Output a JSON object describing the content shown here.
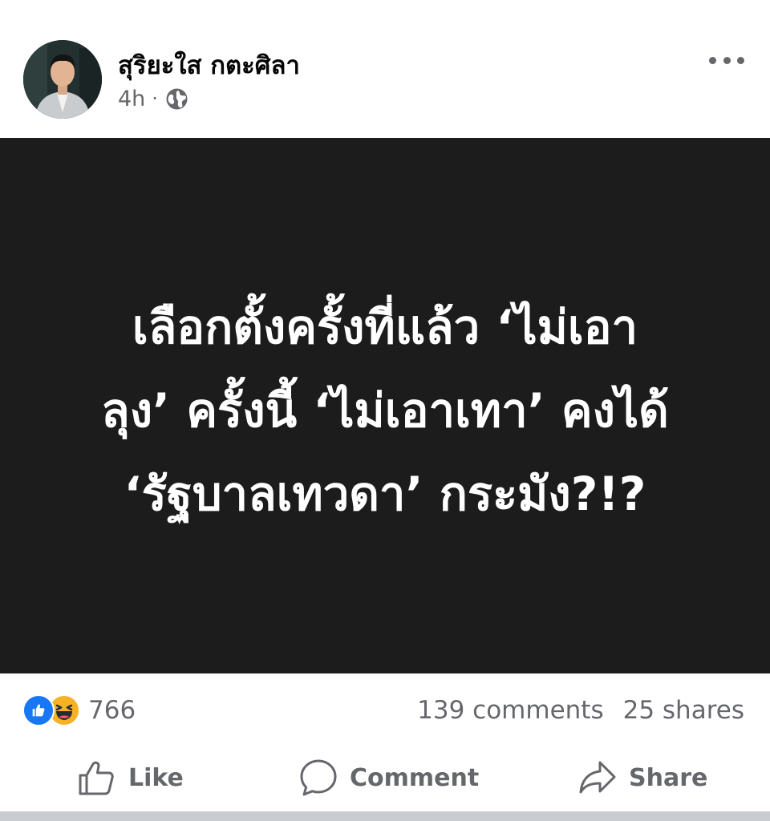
{
  "post": {
    "author": "สุริยะใส กตะศิลา",
    "timestamp": "4h",
    "separator": "·",
    "privacy_icon": "globe-icon",
    "more_icon": "more-horizontal-icon",
    "image_text_lines": [
      "เลือกตั้งครั้งที่แล้ว ‘ไม่เอา",
      "ลุง’ ครั้งนี้ ‘ไม่เอาเทา’ คงได้",
      "‘รัฐบาลเทวดา’ กระมัง?!?"
    ]
  },
  "stats": {
    "reaction_icons": [
      "like-reaction-icon",
      "haha-reaction-icon"
    ],
    "reaction_count": "766",
    "comments": "139 comments",
    "shares": "25 shares"
  },
  "actions": {
    "like_label": "Like",
    "comment_label": "Comment",
    "share_label": "Share"
  },
  "colors": {
    "image_background": "#1c1c1c",
    "image_text": "#ffffff",
    "secondary_text": "#65676b",
    "like_blue": "#1877f2",
    "haha_yellow": "#f7b125",
    "divider": "#c9ccd1"
  }
}
